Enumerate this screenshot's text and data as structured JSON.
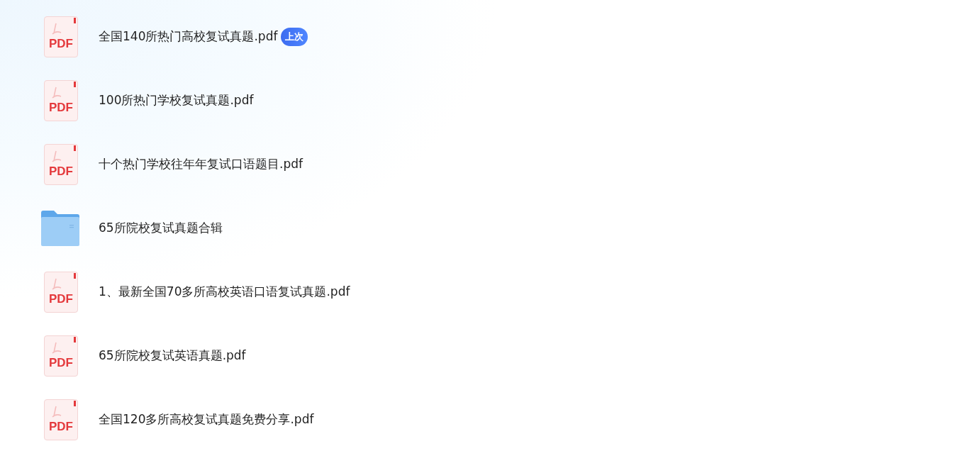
{
  "files": [
    {
      "kind": "pdf",
      "icon_text": "PDF",
      "name": "全国140所热门高校复试真题.pdf",
      "badge": "上次"
    },
    {
      "kind": "pdf",
      "icon_text": "PDF",
      "name": "100所热门学校复试真题.pdf"
    },
    {
      "kind": "pdf",
      "icon_text": "PDF",
      "name": "十个热门学校往年年复试口语题目.pdf"
    },
    {
      "kind": "folder",
      "name": "65所院校复试真题合辑"
    },
    {
      "kind": "pdf",
      "icon_text": "PDF",
      "name": "1、最新全国70多所高校英语口语复试真题.pdf"
    },
    {
      "kind": "pdf",
      "icon_text": "PDF",
      "name": "65所院校复试英语真题.pdf"
    },
    {
      "kind": "pdf",
      "icon_text": "PDF",
      "name": "全国120多所高校复试真题免费分享.pdf"
    }
  ]
}
